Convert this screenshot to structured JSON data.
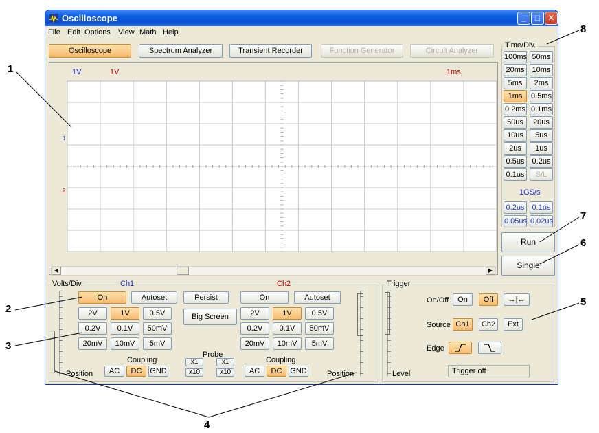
{
  "window": {
    "title": "Oscilloscope"
  },
  "menu": [
    "File",
    "Edit",
    "Options",
    "View",
    "Math",
    "Help"
  ],
  "modes": [
    {
      "label": "Oscilloscope",
      "state": "active"
    },
    {
      "label": "Spectrum Analyzer",
      "state": "normal"
    },
    {
      "label": "Transient Recorder",
      "state": "normal"
    },
    {
      "label": "Function Generator",
      "state": "disabled"
    },
    {
      "label": "Circuit Analyzer",
      "state": "disabled"
    }
  ],
  "screen": {
    "ch1_scale": "1V",
    "ch2_scale": "1V",
    "time_scale": "1ms",
    "ch1_marker": "1",
    "ch2_marker": "2"
  },
  "timediv": {
    "legend": "Time/Div.",
    "buttons": [
      [
        "100ms",
        "50ms"
      ],
      [
        "20ms",
        "10ms"
      ],
      [
        "5ms",
        "2ms"
      ],
      [
        "1ms",
        "0.5ms"
      ],
      [
        "0.2ms",
        "0.1ms"
      ],
      [
        "50us",
        "20us"
      ],
      [
        "10us",
        "5us"
      ],
      [
        "2us",
        "1us"
      ],
      [
        "0.5us",
        "0.2us"
      ],
      [
        "0.1us",
        "S/L"
      ]
    ],
    "selected": "1ms",
    "sample_rate": "1GS/s",
    "fast_buttons": [
      [
        "0.2us",
        "0.1us"
      ],
      [
        "0.05us",
        "0.02us"
      ]
    ]
  },
  "run_label": "Run",
  "single_label": "Single",
  "volts": {
    "legend": "Volts/Div.",
    "ch1": {
      "title": "Ch1",
      "on_label": "On",
      "autoset_label": "Autoset",
      "levels": [
        "2V",
        "1V",
        "0.5V",
        "0.2V",
        "0.1V",
        "50mV",
        "20mV",
        "10mV",
        "5mV"
      ],
      "selected": "1V",
      "coupling_label": "Coupling",
      "coupling": [
        "AC",
        "DC",
        "GND"
      ],
      "coupling_selected": "DC"
    },
    "ch2": {
      "title": "Ch2",
      "on_label": "On",
      "autoset_label": "Autoset",
      "levels": [
        "2V",
        "1V",
        "0.5V",
        "0.2V",
        "0.1V",
        "50mV",
        "20mV",
        "10mV",
        "5mV"
      ],
      "selected": "1V",
      "coupling_label": "Coupling",
      "coupling": [
        "AC",
        "DC",
        "GND"
      ],
      "coupling_selected": "DC"
    },
    "persist_label": "Persist",
    "bigscreen_label": "Big Screen",
    "probe_label": "Probe",
    "probe_options": [
      "x1",
      "x10"
    ],
    "position_label": "Position"
  },
  "trigger": {
    "legend": "Trigger",
    "onoff_label": "On/Off",
    "on_label": "On",
    "off_label": "Off",
    "center_symbol": "→|←",
    "source_label": "Source",
    "sources": [
      "Ch1",
      "Ch2",
      "Ext"
    ],
    "source_selected": "Ch1",
    "edge_label": "Edge",
    "level_label": "Level",
    "status": "Trigger off"
  },
  "callouts": [
    "1",
    "2",
    "3",
    "4",
    "5",
    "6",
    "7",
    "8"
  ],
  "colors": {
    "titlebar": "#0a5ce0",
    "ch1": "#1f2fd0",
    "ch2": "#c00000",
    "active_button": "#f8bb70",
    "grid": "#c8c8c8"
  }
}
